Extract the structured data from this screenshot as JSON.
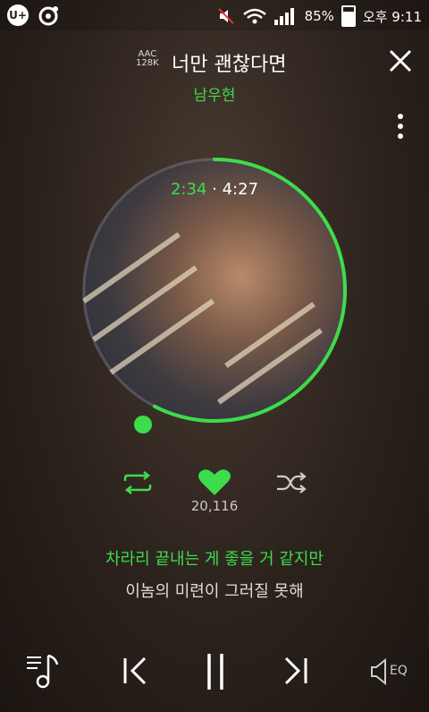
{
  "status_bar": {
    "app_badge": "U+",
    "battery_percent": "85%",
    "time": "오후 9:11"
  },
  "track": {
    "quality_codec": "AAC",
    "quality_bitrate": "128K",
    "title": "너만 괜찮다면",
    "artist": "남우현"
  },
  "progress": {
    "current": "2:34",
    "separator": "·",
    "total": "4:27",
    "fraction": 0.576
  },
  "likes": {
    "count": "20,116"
  },
  "lyrics": {
    "current_line": "차라리 끝내는 게 좋을 거 같지만",
    "next_line": "이놈의 미련이 그러질 못해"
  },
  "colors": {
    "accent": "#3ddc4c",
    "text_secondary": "#cfc8c0"
  },
  "controls": {
    "eq_label": "EQ"
  }
}
